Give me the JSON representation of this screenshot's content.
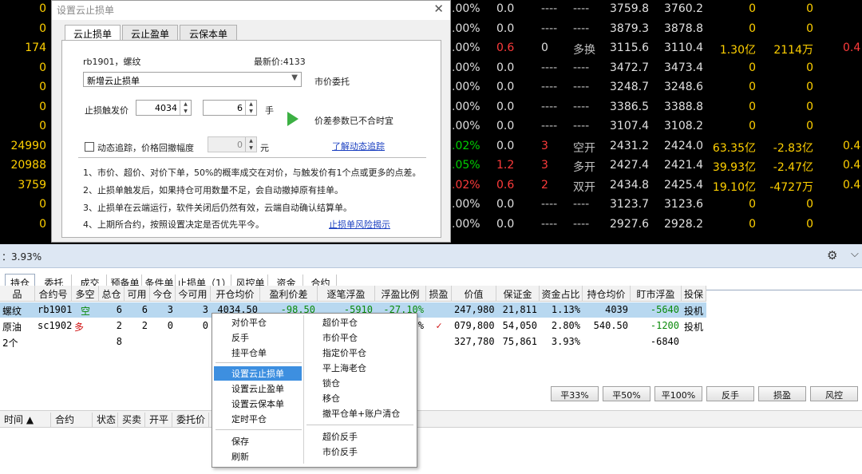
{
  "board_rows": [
    {
      "vol": "0",
      "pct": ".00%",
      "chg": "0.0",
      "now": "----",
      "prop": "----",
      "p1": "3759.8",
      "p2": "3760.2",
      "a1": "0",
      "a2": "0",
      "tail": "",
      "pct_c": "w",
      "chg_c": "w",
      "tail_c": "w"
    },
    {
      "vol": "0",
      "pct": ".00%",
      "chg": "0.0",
      "now": "----",
      "prop": "----",
      "p1": "3879.3",
      "p2": "3878.8",
      "a1": "0",
      "a2": "0",
      "tail": "",
      "pct_c": "w",
      "chg_c": "w",
      "tail_c": "w"
    },
    {
      "vol": "174",
      "pct": ".00%",
      "chg": "0.6",
      "now": "0",
      "prop": "多换",
      "p1": "3115.6",
      "p2": "3110.4",
      "a1": "1.30亿",
      "a2": "2114万",
      "tail": "0.4",
      "pct_c": "w",
      "chg_c": "r",
      "tail_c": "r"
    },
    {
      "vol": "0",
      "pct": ".00%",
      "chg": "0.0",
      "now": "----",
      "prop": "----",
      "p1": "3472.7",
      "p2": "3473.4",
      "a1": "0",
      "a2": "0",
      "tail": "",
      "pct_c": "w",
      "chg_c": "w",
      "tail_c": "w"
    },
    {
      "vol": "0",
      "pct": ".00%",
      "chg": "0.0",
      "now": "----",
      "prop": "----",
      "p1": "3248.7",
      "p2": "3248.6",
      "a1": "0",
      "a2": "0",
      "tail": "",
      "pct_c": "w",
      "chg_c": "w",
      "tail_c": "w"
    },
    {
      "vol": "0",
      "pct": ".00%",
      "chg": "0.0",
      "now": "----",
      "prop": "----",
      "p1": "3386.5",
      "p2": "3388.8",
      "a1": "0",
      "a2": "0",
      "tail": "",
      "pct_c": "w",
      "chg_c": "w",
      "tail_c": "w"
    },
    {
      "vol": "0",
      "pct": ".00%",
      "chg": "0.0",
      "now": "----",
      "prop": "----",
      "p1": "3107.4",
      "p2": "3108.2",
      "a1": "0",
      "a2": "0",
      "tail": "",
      "pct_c": "w",
      "chg_c": "w",
      "tail_c": "w"
    },
    {
      "vol": "24990",
      "pct": ".02%",
      "chg": "0.0",
      "now": "3",
      "prop": "空开",
      "p1": "2431.2",
      "p2": "2424.0",
      "a1": "63.35亿",
      "a2": "-2.83亿",
      "tail": "0.4",
      "pct_c": "g",
      "chg_c": "w",
      "tail_c": "y"
    },
    {
      "vol": "20988",
      "pct": ".05%",
      "chg": "1.2",
      "now": "3",
      "prop": "多开",
      "p1": "2427.4",
      "p2": "2421.4",
      "a1": "39.93亿",
      "a2": "-2.47亿",
      "tail": "0.4",
      "pct_c": "g",
      "chg_c": "r",
      "tail_c": "y"
    },
    {
      "vol": "3759",
      "pct": ".02%",
      "chg": "0.6",
      "now": "2",
      "prop": "双开",
      "p1": "2434.8",
      "p2": "2425.4",
      "a1": "19.10亿",
      "a2": "-4727万",
      "tail": "0.4",
      "pct_c": "r",
      "chg_c": "r",
      "tail_c": "y"
    },
    {
      "vol": "0",
      "pct": ".00%",
      "chg": "0.0",
      "now": "----",
      "prop": "----",
      "p1": "3123.7",
      "p2": "3123.6",
      "a1": "0",
      "a2": "0",
      "tail": "",
      "pct_c": "w",
      "chg_c": "w",
      "tail_c": "w"
    },
    {
      "vol": "0",
      "pct": ".00%",
      "chg": "0.0",
      "now": "----",
      "prop": "----",
      "p1": "2927.6",
      "p2": "2928.2",
      "a1": "0",
      "a2": "0",
      "tail": "",
      "pct_c": "w",
      "chg_c": "w",
      "tail_c": "w"
    }
  ],
  "dialog": {
    "title": "设置云止损单",
    "close": "✕",
    "tabs": [
      "云止损单",
      "云止盈单",
      "云保本单"
    ],
    "contract": "rb1901，螺纹",
    "latest_price": "最新价:4133",
    "order_type": "新增云止损单",
    "order_mode": "市价委托",
    "trigger_label": "止损触发价",
    "trigger_price": "4034",
    "qty": "6",
    "qty_unit": "手",
    "spread_status": "价差参数已不合时宜",
    "dynamic_label": "动态追踪，价格回撤幅度",
    "retrace": "0",
    "retrace_unit": "元",
    "dynamic_link": "了解动态追踪",
    "notes": [
      "1、市价、超价、对价下单，50%的概率成交在对价，与触发价有1个点或更多的点差。",
      "2、止损单触发后，如果持仓可用数量不足，会自动撤掉原有挂单。",
      "3、止损单在云端运行，软件关闭后仍然有效，云端自动确认结算单。",
      "4、上期所合约，按照设置决定是否优先平今。"
    ],
    "risk_link": "止损单风险揭示"
  },
  "ratio_bar": {
    "text": "：3.93%"
  },
  "tabs": [
    "持仓",
    "委托",
    "成交",
    "预备单",
    "条件单",
    "止损单（1）",
    "风控单",
    "资金",
    "合约"
  ],
  "position_headers": [
    "品",
    "合约号",
    "多空",
    "总仓",
    "可用",
    "今仓",
    "今可用",
    "开仓均价",
    "盈利价差",
    "逐笔浮盈",
    "浮盈比例",
    "损盈",
    "价值",
    "保证金",
    "资金占比",
    "持仓均价",
    "盯市浮盈",
    "投保"
  ],
  "position_rows": [
    {
      "name": "螺纹",
      "code": "rb1901",
      "dir": "空",
      "total": "6",
      "avail": "6",
      "today": "3",
      "today_avail": "3",
      "open_avg": "4034.50",
      "profit_diff": "-98.50",
      "float_pl": "-5910",
      "float_ratio": "-27.10%",
      "loss": "",
      "value": "247,980",
      "margin": "21,811",
      "fund_ratio": "1.13%",
      "hold_avg": "4039",
      "mtm": "-5640",
      "hedge": "投机"
    },
    {
      "name": "原油",
      "code": "sc1902",
      "dir": "多",
      "total": "2",
      "avail": "2",
      "today": "0",
      "today_avail": "0",
      "open_avg": "",
      "profit_diff": "",
      "float_pl": "",
      "float_ratio": "%",
      "loss": "✓",
      "value": "079,800",
      "margin": "54,050",
      "fund_ratio": "2.80%",
      "hold_avg": "540.50",
      "mtm": "-1200",
      "hedge": "投机"
    },
    {
      "name": "2个",
      "code": "",
      "dir": "",
      "total": "8",
      "avail": "",
      "today": "",
      "today_avail": "",
      "open_avg": "",
      "profit_diff": "",
      "float_pl": "",
      "float_ratio": "",
      "loss": "",
      "value": "327,780",
      "margin": "75,861",
      "fund_ratio": "3.93%",
      "hold_avg": "",
      "mtm": "-6840",
      "hedge": ""
    }
  ],
  "action_buttons": [
    "平33%",
    "平50%",
    "平100%",
    "反手",
    "损盈",
    "风控"
  ],
  "order_headers": [
    "时间 ▲",
    "合约",
    "状态",
    "买卖",
    "开平",
    "委托价"
  ],
  "context_menu": {
    "left": [
      "对价平仓",
      "反手",
      "挂平仓单",
      "设置云止损单",
      "设置云止盈单",
      "设置云保本单",
      "定时平仓",
      "保存",
      "刷新"
    ],
    "right": [
      "超价平仓",
      "市价平仓",
      "指定价平仓",
      "平上海老仓",
      "锁仓",
      "移仓",
      "撤平仓单+账户清仓",
      "超价反手",
      "市价反手"
    ],
    "highlighted": "设置云止损单"
  },
  "colors": {
    "up": "#ff3b3b",
    "down": "#00d000",
    "accent": "#3d8fe0",
    "selection": "#b8d8f0"
  }
}
